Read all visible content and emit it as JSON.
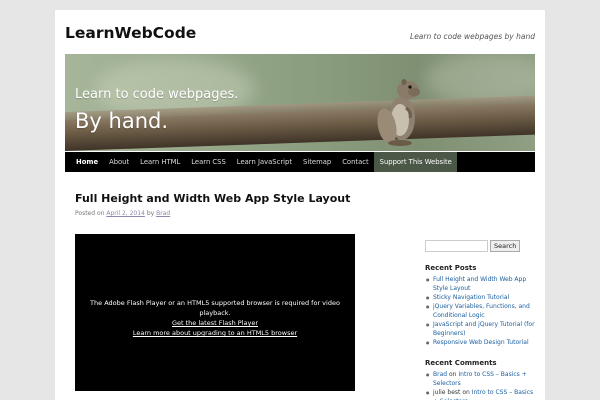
{
  "site": {
    "title": "LearnWebCode",
    "description": "Learn to code webpages by hand"
  },
  "banner": {
    "line1": "Learn to code webpages.",
    "line2": "By hand."
  },
  "nav": {
    "items": [
      {
        "label": "Home",
        "active": true
      },
      {
        "label": "About"
      },
      {
        "label": "Learn HTML"
      },
      {
        "label": "Learn CSS"
      },
      {
        "label": "Learn JavaScript"
      },
      {
        "label": "Sitemap"
      },
      {
        "label": "Contact"
      },
      {
        "label": "Support This Website",
        "highlight": true
      }
    ]
  },
  "post": {
    "title": "Full Height and Width Web App Style Layout",
    "posted_on": "Posted on",
    "date": "April 2, 2014",
    "by": "by",
    "author": "Brad"
  },
  "video": {
    "message": "The Adobe Flash Player or an HTML5 supported browser is required for video playback.",
    "link1": "Get the latest Flash Player",
    "link2": "Learn more about upgrading to an HTML5 browser"
  },
  "sidebar": {
    "search_button": "Search",
    "search_value": "",
    "recent_posts_title": "Recent Posts",
    "recent_posts": [
      "Full Height and Width Web App Style Layout",
      "Sticky Navigation Tutorial",
      "jQuery Variables, Functions, and Conditional Logic",
      "JavaScript and jQuery Tutorial (for Beginners)",
      "Responsive Web Design Tutorial"
    ],
    "recent_comments_title": "Recent Comments",
    "recent_comments": [
      {
        "author": "Brad",
        "on": "on",
        "post": "Intro to CSS – Basics + Selectors"
      },
      {
        "author": "julie best",
        "on": "on",
        "post": "Intro to CSS – Basics + Selectors"
      }
    ]
  },
  "colors": {
    "nav_bg": "#000000",
    "support_bg": "#4b5848",
    "link": "#1b5fa0"
  }
}
